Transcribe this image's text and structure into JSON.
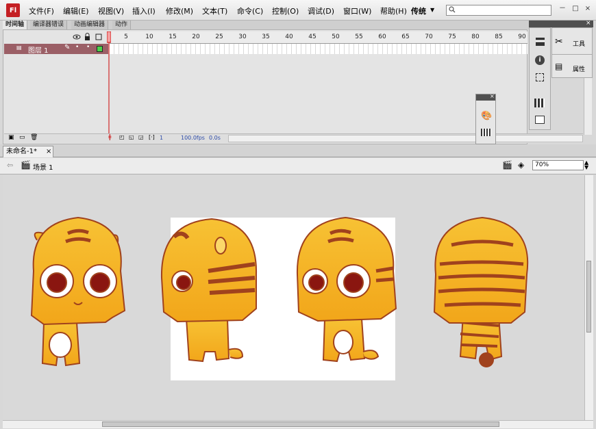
{
  "app": {
    "logo": "Fl"
  },
  "menu": [
    "文件(F)",
    "编辑(E)",
    "视图(V)",
    "插入(I)",
    "修改(M)",
    "文本(T)",
    "命令(C)",
    "控制(O)",
    "调试(D)",
    "窗口(W)",
    "帮助(H)"
  ],
  "workspace": "传统",
  "window_controls": [
    "－",
    "□",
    "×"
  ],
  "timeline": {
    "tabs": [
      "时间轴",
      "编译器错误",
      "动画编辑器",
      "动作"
    ],
    "layer_name": "图层 1",
    "ruler": [
      "5",
      "10",
      "15",
      "20",
      "25",
      "30",
      "35",
      "40",
      "45",
      "50",
      "55",
      "60",
      "65",
      "70",
      "75",
      "80",
      "85",
      "90"
    ],
    "status": {
      "frame": "1",
      "fps": "100.0fps",
      "time": "0.0s"
    }
  },
  "panels": {
    "tools": "工具",
    "properties": "属性"
  },
  "document": {
    "tab": "未命名-1*",
    "scene": "场景 1",
    "zoom": "70%"
  },
  "icons": [
    "flash-logo-icon",
    "search-icon",
    "minimize-icon",
    "maximize-icon",
    "close-icon",
    "eye-icon",
    "lock-icon",
    "outline-icon",
    "pencil-icon",
    "layer-icon",
    "new-layer-icon",
    "folder-icon",
    "trash-icon",
    "back-arrow-icon",
    "scene-icon",
    "edit-symbols-icon",
    "edit-scene-icon",
    "align-icon",
    "info-icon",
    "transform-icon",
    "library-icon",
    "swatch-icon",
    "color-icon",
    "tools-icon",
    "properties-icon"
  ],
  "colors": {
    "accent_red": "#c41f23",
    "layer_row": "#9b5f66",
    "tiger_orange": "#f6b21b",
    "tiger_stripe": "#a0421d",
    "stage": "#ffffff",
    "canvas": "#d9d9d9"
  }
}
